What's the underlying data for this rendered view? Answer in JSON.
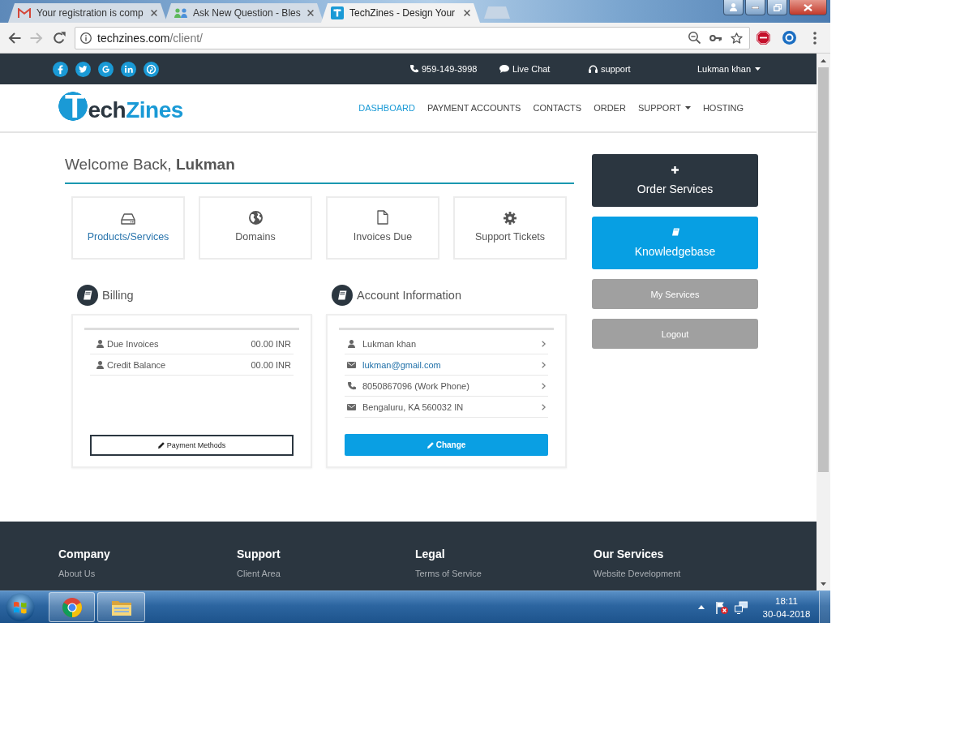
{
  "browser": {
    "tabs": [
      {
        "title": "Your registration is comp",
        "selected": false
      },
      {
        "title": "Ask New Question - Bles",
        "selected": false
      },
      {
        "title": "TechZines - Design Your",
        "selected": true
      }
    ],
    "forward_enabled": false,
    "address": {
      "host": "techzines.com",
      "path": "/client/"
    }
  },
  "topbar": {
    "contacts": [
      "959-149-3998",
      "Live Chat",
      "support"
    ],
    "user": "Lukman khan"
  },
  "header": {
    "logo": {
      "badge": "T",
      "text": "ech",
      "accent": "Zines"
    },
    "nav": [
      {
        "label": "DASHBOARD",
        "selected": true,
        "dropdown": false
      },
      {
        "label": "PAYMENT ACCOUNTS",
        "selected": false,
        "dropdown": false
      },
      {
        "label": "CONTACTS",
        "selected": false,
        "dropdown": false
      },
      {
        "label": "ORDER",
        "selected": false,
        "dropdown": false
      },
      {
        "label": "SUPPORT",
        "selected": false,
        "dropdown": true
      },
      {
        "label": "HOSTING",
        "selected": false,
        "dropdown": false
      }
    ]
  },
  "welcome": "Welcome Back, **Lukman**",
  "tiles": [
    {
      "label": "Products/Services",
      "selected": true
    },
    {
      "label": "Domains",
      "selected": false
    },
    {
      "label": "Invoices Due",
      "selected": false
    },
    {
      "label": "Support Tickets",
      "selected": false
    }
  ],
  "billing": {
    "title": "Billing",
    "rows": [
      {
        "label": "Due Invoices",
        "value": "00.00 INR"
      },
      {
        "label": "Credit Balance",
        "value": "00.00 INR"
      }
    ],
    "button": "Payment Methods"
  },
  "account": {
    "title": "Account Information",
    "rows": [
      {
        "kind": "name",
        "text": "Lukman khan"
      },
      {
        "kind": "email",
        "text": "lukman@gmail.com"
      },
      {
        "kind": "phone",
        "text": "8050867096 (Work Phone)"
      },
      {
        "kind": "address",
        "text": "Bengaluru, KA 560032 IN"
      }
    ],
    "button": "Change"
  },
  "sidebar": [
    {
      "kind": "order",
      "label": "Order Services"
    },
    {
      "kind": "knowledge",
      "label": "Knowledgebase"
    },
    {
      "kind": "plain",
      "label": "My Services"
    },
    {
      "kind": "plain",
      "label": "Logout"
    }
  ],
  "footer": {
    "columns": [
      {
        "heading": "Company",
        "links": [
          "About Us"
        ]
      },
      {
        "heading": "Support",
        "links": [
          "Client Area"
        ]
      },
      {
        "heading": "Legal",
        "links": [
          "Terms of Service"
        ]
      },
      {
        "heading": "Our Services",
        "links": [
          "Website Development"
        ]
      }
    ]
  },
  "taskbar": {
    "time": "18:11",
    "date": "30-04-2018"
  }
}
